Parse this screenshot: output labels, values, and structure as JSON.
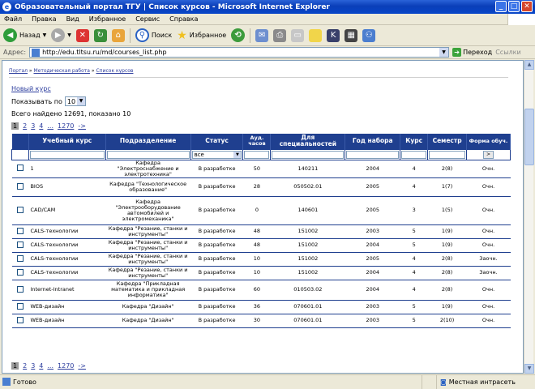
{
  "window": {
    "title": "Образовательный портал ТГУ | Список курсов - Microsoft Internet Explorer"
  },
  "menu": [
    "Файл",
    "Правка",
    "Вид",
    "Избранное",
    "Сервис",
    "Справка"
  ],
  "toolbar": {
    "back": "Назад",
    "search": "Поиск",
    "favorites": "Избранное"
  },
  "address": {
    "label": "Адрес:",
    "url": "http://edu.tltsu.ru/md/courses_list.php",
    "go": "Переход",
    "links": "Ссылки"
  },
  "breadcrumb": [
    "Портал",
    "Методическая работа",
    "Список курсов"
  ],
  "new_course": "Новый курс",
  "show_per_page": {
    "label": "Показывать по",
    "value": "10"
  },
  "found_text": "Всего найдено 12691, показано 10",
  "pager": {
    "current": "1",
    "pages": [
      "2",
      "3",
      "4",
      "...",
      "1270",
      "->"
    ]
  },
  "table": {
    "headers": [
      "Учебный курс",
      "Подразделение",
      "Статус",
      "Ауд. часов",
      "Для специальностей",
      "Год набора",
      "Курс",
      "Семестр",
      "Форма обуч."
    ],
    "filter": {
      "status": "все",
      "go": ">"
    },
    "rows": [
      {
        "course": "1",
        "dept": "Кафедра \"Электроснабжение и электротехника\"",
        "status": "В разработке",
        "hours": "50",
        "spec": "140211",
        "year": "2004",
        "kurs": "4",
        "sem": "2(8)",
        "form": "Очн."
      },
      {
        "course": "BIOS",
        "dept": "Кафедра \"Технологическое образование\"",
        "status": "В разработке",
        "hours": "28",
        "spec": "050502.01",
        "year": "2005",
        "kurs": "4",
        "sem": "1(7)",
        "form": "Очн."
      },
      {
        "course": "CAD/CAM",
        "dept": "Кафедра \"Электрооборудование автомобилей и электромеханика\"",
        "status": "В разработке",
        "hours": "0",
        "spec": "140601",
        "year": "2005",
        "kurs": "3",
        "sem": "1(5)",
        "form": "Очн."
      },
      {
        "course": "CALS-технологии",
        "dept": "Кафедра \"Резание, станки и инструменты\"",
        "status": "В разработке",
        "hours": "48",
        "spec": "151002",
        "year": "2003",
        "kurs": "5",
        "sem": "1(9)",
        "form": "Очн."
      },
      {
        "course": "CALS-технологии",
        "dept": "Кафедра \"Резание, станки и инструменты\"",
        "status": "В разработке",
        "hours": "48",
        "spec": "151002",
        "year": "2004",
        "kurs": "5",
        "sem": "1(9)",
        "form": "Очн."
      },
      {
        "course": "CALS-технологии",
        "dept": "Кафедра \"Резание, станки и инструменты\"",
        "status": "В разработке",
        "hours": "10",
        "spec": "151002",
        "year": "2005",
        "kurs": "4",
        "sem": "2(8)",
        "form": "Заочн."
      },
      {
        "course": "CALS-технологии",
        "dept": "Кафедра \"Резание, станки и инструменты\"",
        "status": "В разработке",
        "hours": "10",
        "spec": "151002",
        "year": "2004",
        "kurs": "4",
        "sem": "2(8)",
        "form": "Заочн."
      },
      {
        "course": "Internet-Intranet",
        "dept": "Кафедра \"Прикладная математика и прикладная информатика\"",
        "status": "В разработке",
        "hours": "60",
        "spec": "010503.02",
        "year": "2004",
        "kurs": "4",
        "sem": "2(8)",
        "form": "Очн."
      },
      {
        "course": "WEB-дизайн",
        "dept": "Кафедра \"Дизайн\"",
        "status": "В разработке",
        "hours": "36",
        "spec": "070601.01",
        "year": "2003",
        "kurs": "5",
        "sem": "1(9)",
        "form": "Очн."
      },
      {
        "course": "WEB-дизайн",
        "dept": "Кафедра \"Дизайн\"",
        "status": "В разработке",
        "hours": "30",
        "spec": "070601.01",
        "year": "2003",
        "kurs": "5",
        "sem": "2(10)",
        "form": "Очн."
      }
    ]
  },
  "status": {
    "left": "Готово",
    "zone": "Местная интрасеть"
  }
}
